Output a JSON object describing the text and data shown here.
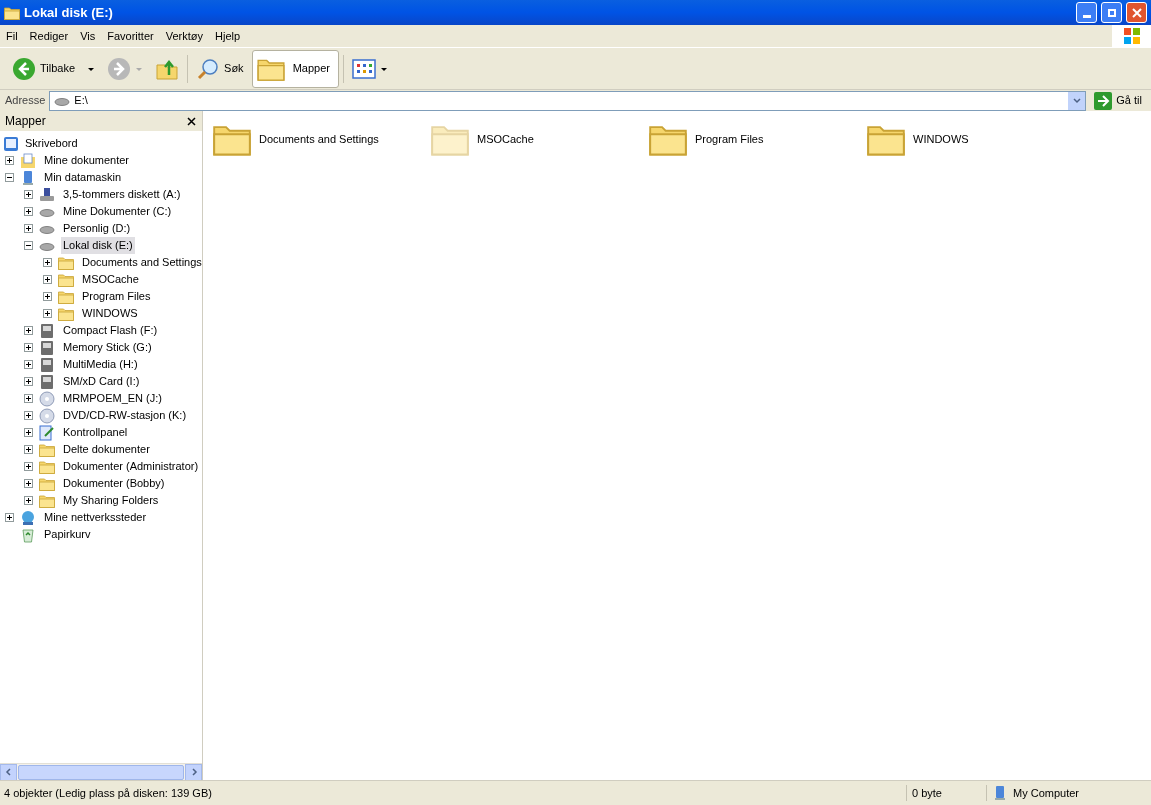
{
  "window": {
    "title": "Lokal disk (E:)"
  },
  "menu": [
    "Fil",
    "Rediger",
    "Vis",
    "Favoritter",
    "Verktøy",
    "Hjelp"
  ],
  "toolbar": {
    "back": "Tilbake",
    "search": "Søk",
    "folders": {
      "label": "Mapper",
      "selected": true
    }
  },
  "address": {
    "label": "Adresse",
    "value": "E:\\",
    "go": "Gå til"
  },
  "folders_pane": {
    "title": "Mapper",
    "tree": {
      "label": "Skrivebord",
      "kind": "desktop",
      "children": [
        {
          "label": "Mine dokumenter",
          "kind": "documents",
          "expanded": false,
          "selected": false
        },
        {
          "label": "Min datamaskin",
          "kind": "computer",
          "expanded": true,
          "selected": false,
          "children": [
            {
              "label": "3,5-tommers diskett (A:)",
              "kind": "floppy",
              "expanded": false,
              "selected": false
            },
            {
              "label": "Mine Dokumenter (C:)",
              "kind": "drive",
              "expanded": false,
              "selected": false
            },
            {
              "label": "Personlig (D:)",
              "kind": "drive",
              "expanded": false,
              "selected": false
            },
            {
              "label": "Lokal disk (E:)",
              "kind": "drive",
              "expanded": true,
              "selected": true,
              "children": [
                {
                  "label": "Documents and Settings",
                  "kind": "folder",
                  "expanded": false,
                  "selected": false
                },
                {
                  "label": "MSOCache",
                  "kind": "folder",
                  "expanded": false,
                  "selected": false
                },
                {
                  "label": "Program Files",
                  "kind": "folder",
                  "expanded": false,
                  "selected": false
                },
                {
                  "label": "WINDOWS",
                  "kind": "folder",
                  "expanded": false,
                  "selected": false
                }
              ]
            },
            {
              "label": "Compact Flash (F:)",
              "kind": "card",
              "expanded": false,
              "selected": false
            },
            {
              "label": "Memory Stick (G:)",
              "kind": "card",
              "expanded": false,
              "selected": false
            },
            {
              "label": "MultiMedia (H:)",
              "kind": "card",
              "expanded": false,
              "selected": false
            },
            {
              "label": "SM/xD Card (I:)",
              "kind": "card",
              "expanded": false,
              "selected": false
            },
            {
              "label": "MRMPOEM_EN (J:)",
              "kind": "cd",
              "expanded": false,
              "selected": false
            },
            {
              "label": "DVD/CD-RW-stasjon (K:)",
              "kind": "cd",
              "expanded": false,
              "selected": false
            },
            {
              "label": "Kontrollpanel",
              "kind": "control-panel",
              "expanded": false,
              "selected": false
            },
            {
              "label": "Delte dokumenter",
              "kind": "folder",
              "expanded": false,
              "selected": false
            },
            {
              "label": "Dokumenter (Administrator)",
              "kind": "folder",
              "expanded": false,
              "selected": false
            },
            {
              "label": "Dokumenter (Bobby)",
              "kind": "folder",
              "expanded": false,
              "selected": false
            },
            {
              "label": "My Sharing Folders",
              "kind": "folder",
              "expanded": false,
              "selected": false
            }
          ]
        },
        {
          "label": "Mine nettverkssteder",
          "kind": "network",
          "expanded": false,
          "selected": false
        },
        {
          "label": "Papirkurv",
          "kind": "recycle",
          "expandable": false,
          "selected": false
        }
      ]
    }
  },
  "files": [
    {
      "name": "Documents and Settings",
      "hidden": false
    },
    {
      "name": "MSOCache",
      "hidden": true
    },
    {
      "name": "Program Files",
      "hidden": false
    },
    {
      "name": "WINDOWS",
      "hidden": false
    }
  ],
  "status_bar": {
    "summary": "4 objekter (Ledig plass på disken: 139 GB)",
    "size": "0 byte",
    "zone": "My Computer"
  }
}
